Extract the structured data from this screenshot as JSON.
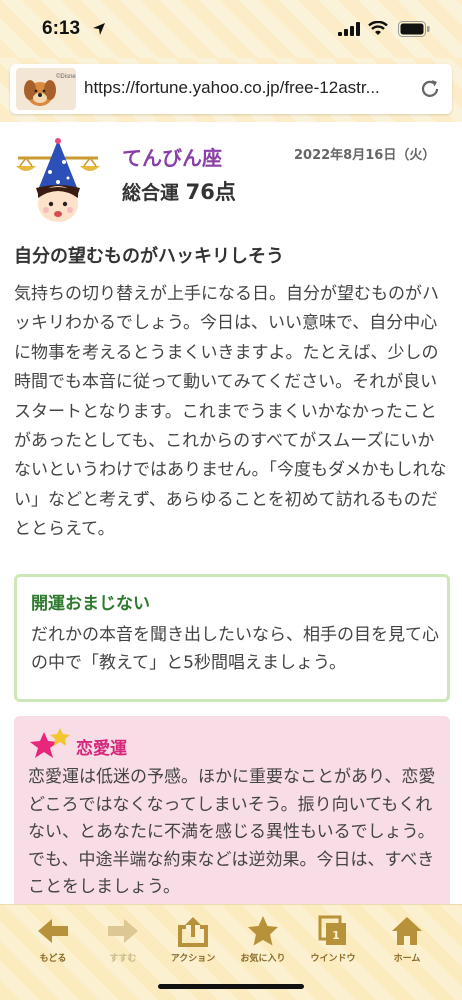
{
  "status": {
    "time": "6:13"
  },
  "browser": {
    "url": "https://fortune.yahoo.co.jp/free-12astr..."
  },
  "header": {
    "sign_name": "てんびん座",
    "date": "2022年8月16日（火）",
    "score_label": "総合運",
    "score_value": "76点"
  },
  "fortune": {
    "headline": "自分の望むものがハッキリしそう",
    "body": "気持ちの切り替えが上手になる日。自分が望むものがハッキリわかるでしょう。今日は、いい意味で、自分中心に物事を考えるとうまくいきますよ。たとえば、少しの時間でも本音に従って動いてみてください。それが良いスタートとなります。これまでうまくいかなかったことがあったとしても、これからのすべてがスムーズにいかないというわけではありません。「今度もダメかもしれない」などと考えず、あらゆることを初めて訪れるものだととらえて。"
  },
  "lucky": {
    "title": "開運おまじない",
    "text": "だれかの本音を聞き出したいなら、相手の目を見て心の中で「教えて」と5秒間唱えましょう。"
  },
  "love": {
    "title": "恋愛運",
    "text": "恋愛運は低迷の予感。ほかに重要なことがあり、恋愛どころではなくなってしまいそう。振り向いてもくれない、とあなたに不満を感じる異性もいるでしょう。でも、中途半端な約束などは逆効果。今日は、すべきことをしましょう。"
  },
  "toolbar": {
    "back": "もどる",
    "forward": "すすむ",
    "action": "アクション",
    "favorites": "お気に入り",
    "windows": "ウインドウ",
    "windows_count": "1",
    "home": "ホーム"
  },
  "colors": {
    "sign_name": "#8a3fa8",
    "lucky_title": "#2f7a2f",
    "love_title": "#d6287b",
    "toolbar_icon": "#b8923a"
  }
}
